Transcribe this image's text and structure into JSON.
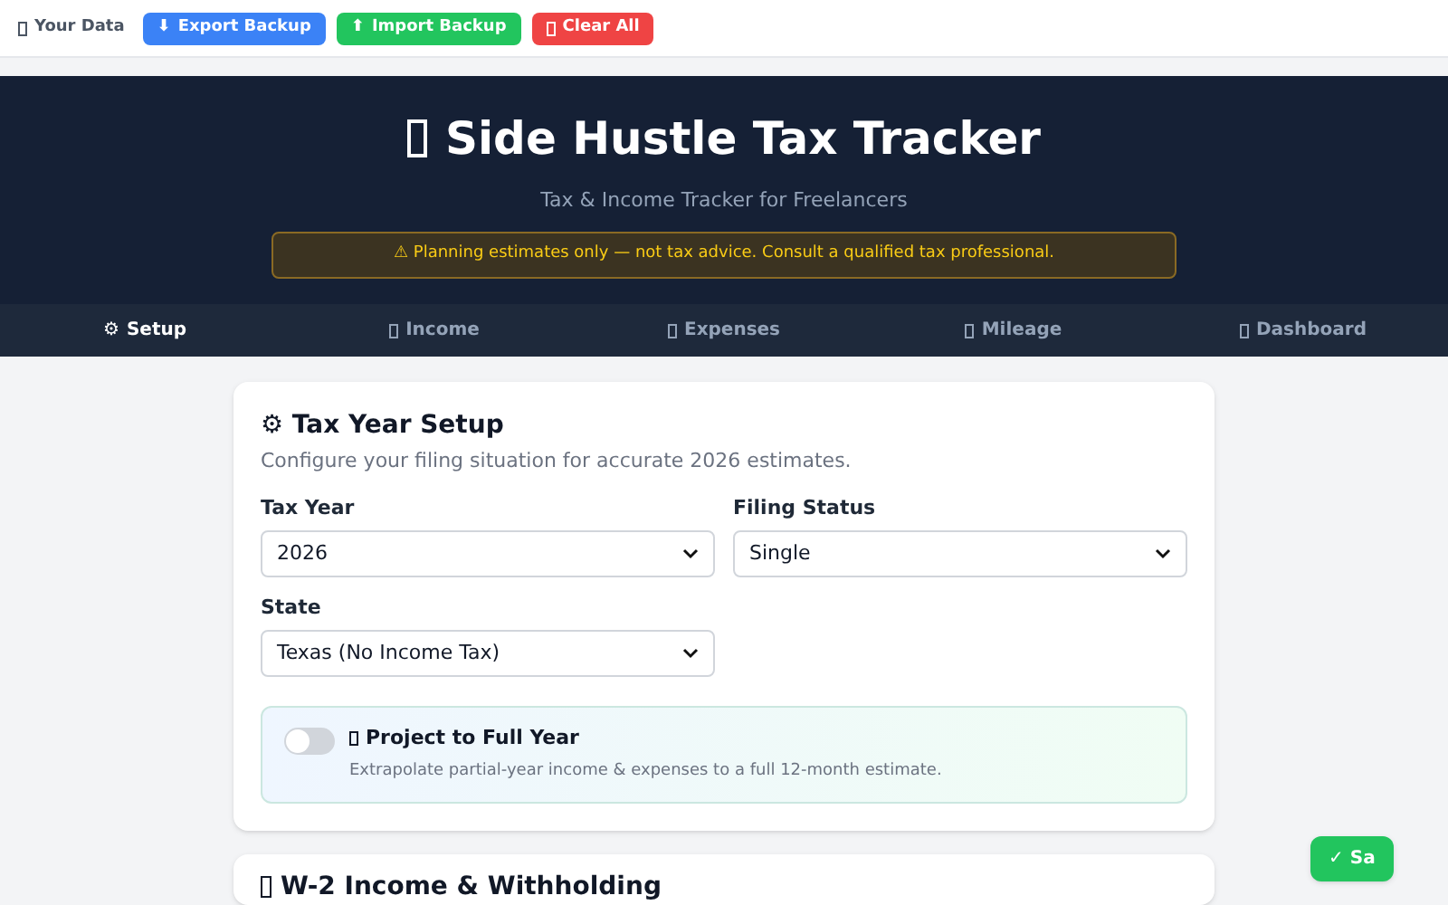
{
  "toolbar": {
    "label": "Your Data",
    "buttons": [
      {
        "kind": "export",
        "glyph": "⬇",
        "label": "Export Backup"
      },
      {
        "kind": "import",
        "glyph": "⬆",
        "label": "Import Backup"
      },
      {
        "kind": "clear",
        "label": "Clear All"
      }
    ]
  },
  "header": {
    "title": "Side Hustle Tax Tracker",
    "subtitle": "Tax & Income Tracker for Freelancers",
    "notice": "⚠ Planning estimates only — not tax advice. Consult a qualified tax professional."
  },
  "tabs": [
    {
      "glyph": "⚙",
      "label": "Setup",
      "selected": true
    },
    {
      "label": "Income",
      "selected": false
    },
    {
      "label": "Expenses",
      "selected": false
    },
    {
      "label": "Mileage",
      "selected": false
    },
    {
      "label": "Dashboard",
      "selected": false
    }
  ],
  "setup_card": {
    "title": "⚙ Tax Year Setup",
    "description": "Configure your filing situation for accurate 2026 estimates.",
    "fields": [
      {
        "label": "Tax Year",
        "value": "2026"
      },
      {
        "label": "Filing Status",
        "value": "Single"
      },
      {
        "label": "State",
        "value": "Texas (No Income Tax)"
      }
    ],
    "projection": {
      "title": "Project to Full Year",
      "description": "Extrapolate partial-year income & expenses to a full 12-month estimate.",
      "on": false
    }
  },
  "w2_card": {
    "title": "W-2 Income & Withholding"
  },
  "save_button": {
    "label": "✓ Sa"
  }
}
